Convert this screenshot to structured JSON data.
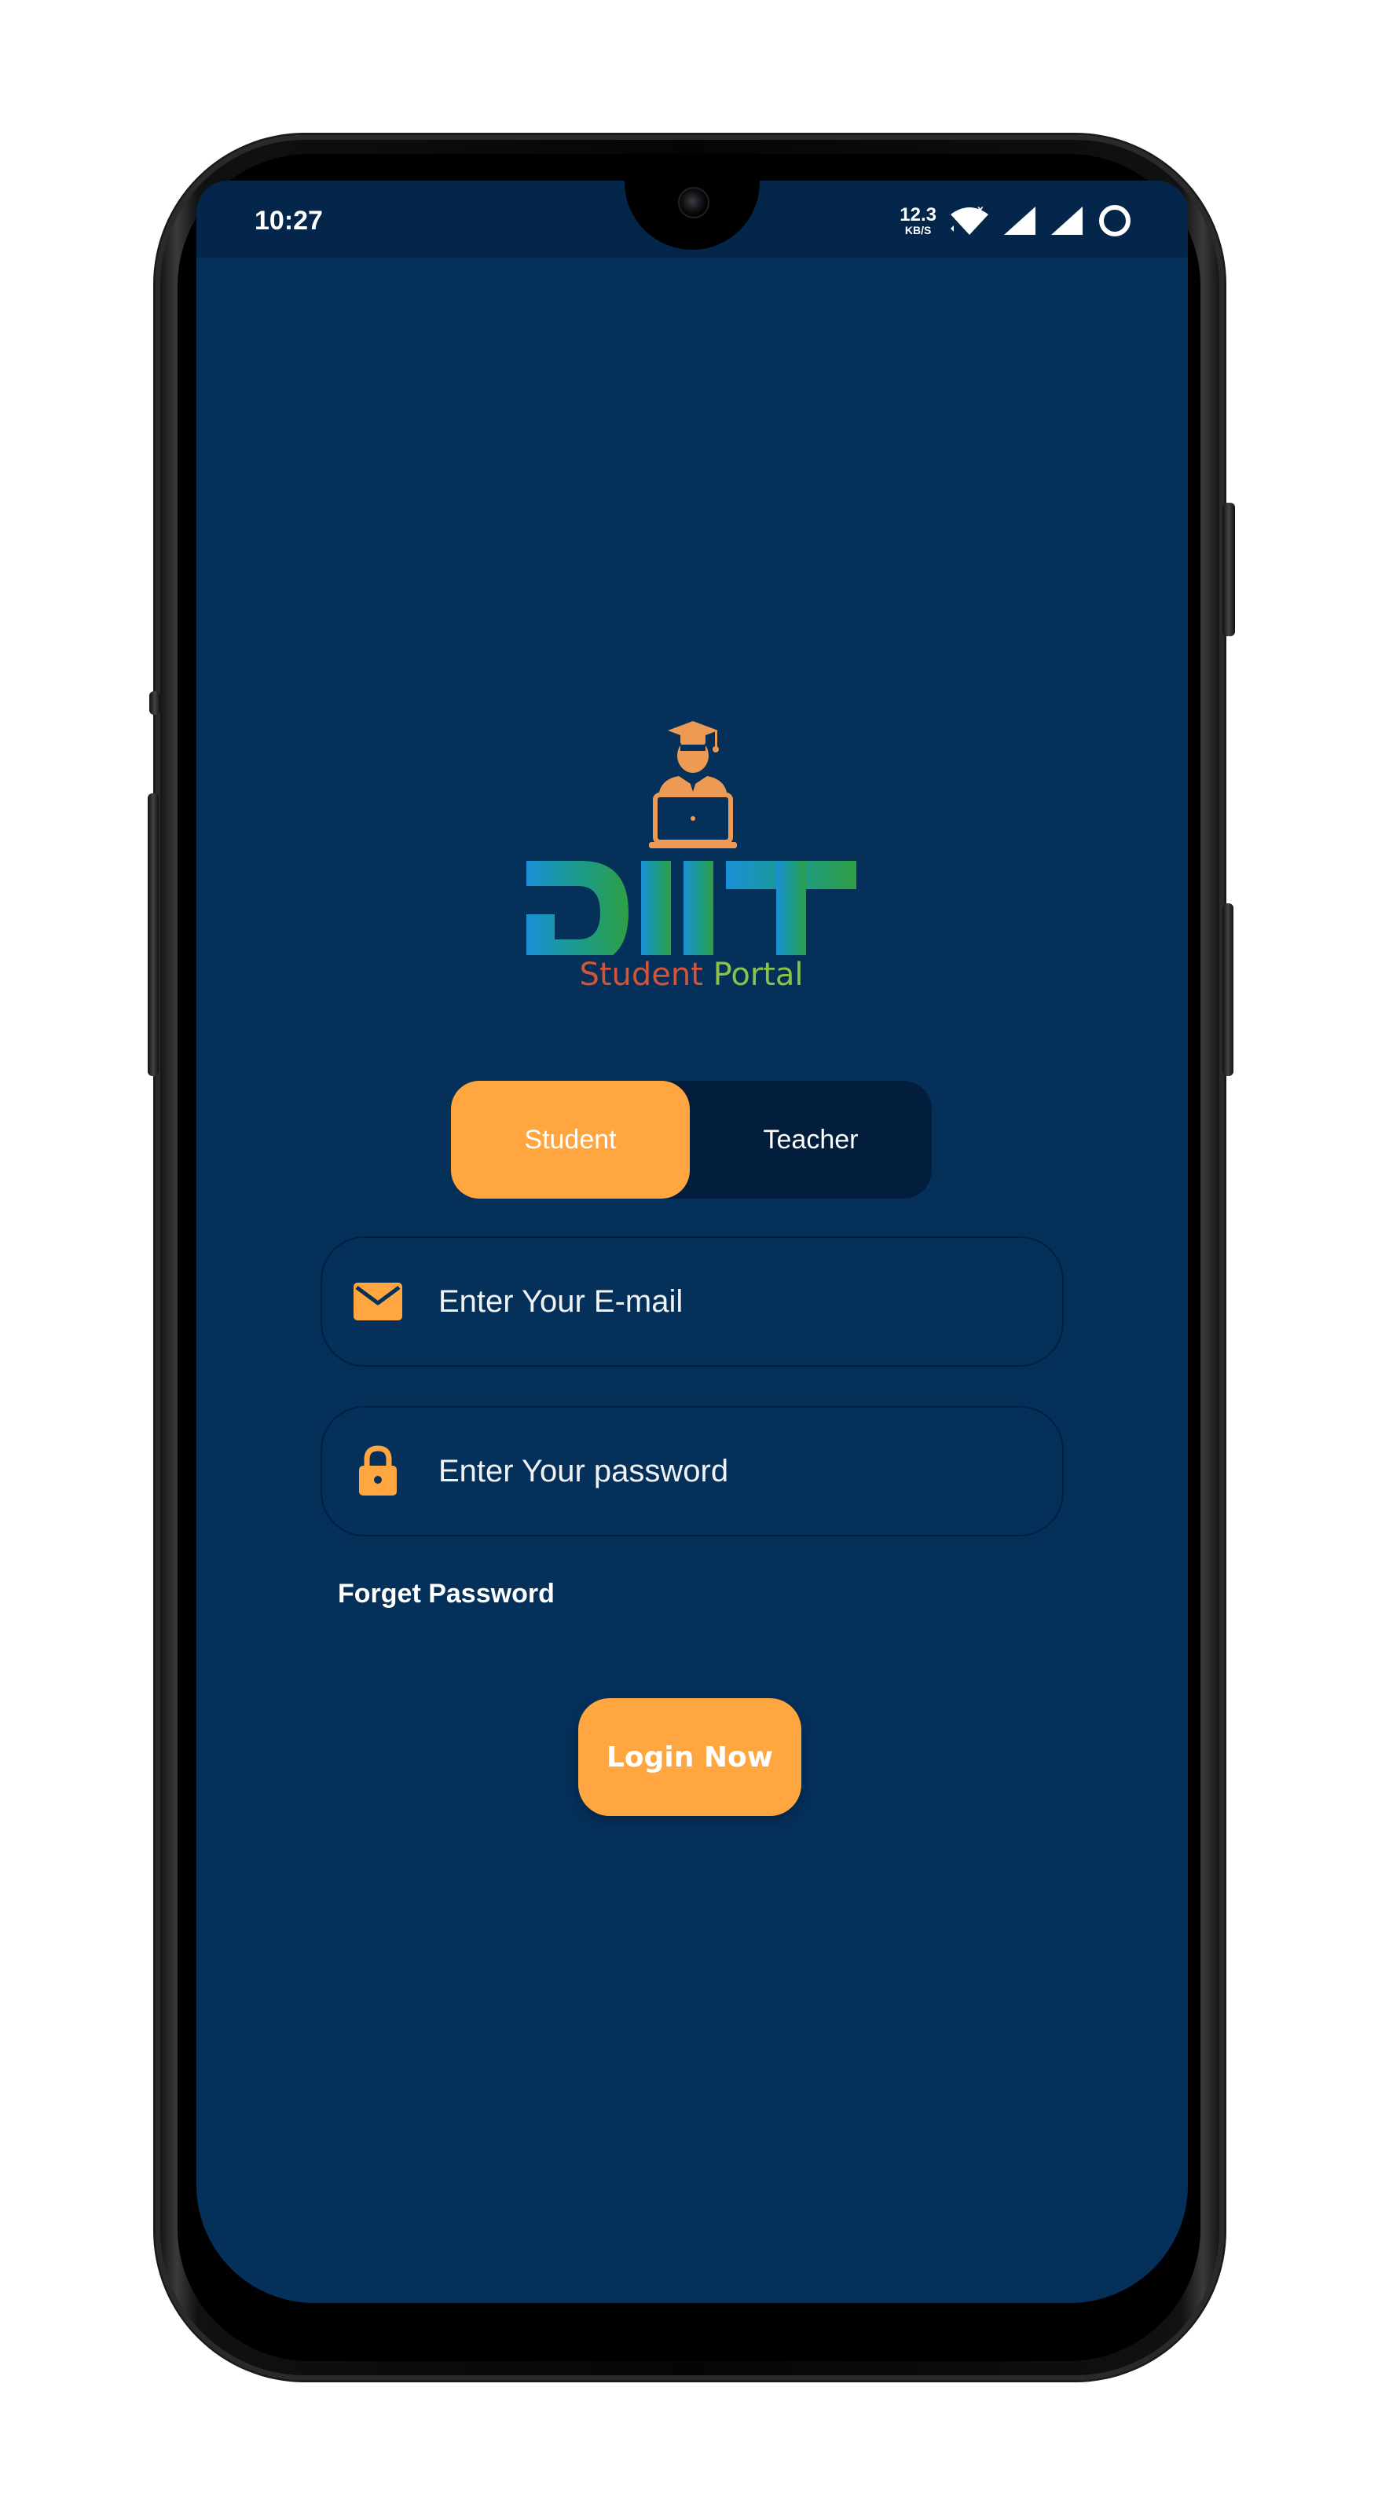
{
  "status_bar": {
    "time": "10:27",
    "net_speed_value": "12.3",
    "net_speed_unit": "KB/S",
    "icons": [
      "wifi-icon",
      "signal-icon",
      "signal-icon",
      "battery-ring-icon"
    ]
  },
  "logo": {
    "name": "DIIT",
    "tagline_part1": "Student ",
    "tagline_part2": "Portal",
    "icon": "graduate-laptop-icon"
  },
  "role_toggle": {
    "options": [
      "Student",
      "Teacher"
    ],
    "selected": "Student"
  },
  "form": {
    "email_placeholder": "Enter Your E-mail",
    "email_value": "",
    "password_placeholder": "Enter Your password",
    "password_value": "",
    "forget_password": "Forget Password",
    "login_button": "Login Now"
  },
  "colors": {
    "background": "#05305a",
    "status_bar": "#04264a",
    "accent": "#ffa640",
    "toggle_bg": "#031e3c",
    "logo_blue": "#1a8fd6",
    "logo_teal": "#1c9b86",
    "logo_green": "#2f9e44"
  }
}
